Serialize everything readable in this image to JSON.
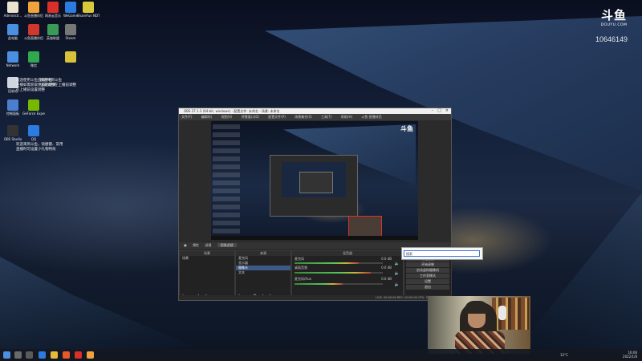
{
  "desktop": {
    "icons": [
      {
        "label": "Administr...",
        "color": "#e9e3d0"
      },
      {
        "label": "斗鱼直播伴侣",
        "color": "#f2a23a"
      },
      {
        "label": "网易云音乐",
        "color": "#d9302a"
      },
      {
        "label": "WeGame",
        "color": "#2b7be0"
      },
      {
        "label": "ShareFun NDTV",
        "color": "#d9c93a"
      },
      {
        "label": "此电脑",
        "color": "#4a8fe0"
      },
      {
        "label": "斗鱼直播伴侣",
        "color": "#d0382e"
      },
      {
        "label": "英雄联盟",
        "color": "#3a9a56"
      },
      {
        "label": "Steam",
        "color": "#777777"
      },
      {
        "label": "Network",
        "color": "#4a8fe0"
      },
      {
        "label": "微信",
        "color": "#2fa84e"
      },
      {
        "label": "",
        "color": "#d8c23a"
      },
      {
        "label": "回收站",
        "color": "#cfd6df"
      },
      {
        "label": "控制面板",
        "color": "#4a7fd0"
      },
      {
        "label": "GeForce Experience",
        "color": "#76b900"
      },
      {
        "label": "OBS Studio",
        "color": "#333333"
      },
      {
        "label": "QQ",
        "color": "#2b7be0"
      }
    ],
    "notes": [
      "欢迎使用斗鱼直播伴侣",
      "主播如需获取更多功能请",
      "在上播前设置调整",
      "欢迎来到斗鱼，快捷键、常用",
      "直播时可设置小礼物特效",
      "欢迎来到斗鱼",
      "设置调整在上播前调整"
    ]
  },
  "brand": {
    "logo": "斗鱼",
    "domain": "DOUYU.COM",
    "room_number": "10646149"
  },
  "obs": {
    "title": "OBS 27.1.3 (64-bit, windows) - 配置文件: 未命名 - 场景: 未命名",
    "menu": [
      "文件(F)",
      "编辑(E)",
      "视图(V)",
      "停靠窗口(D)",
      "配置文件(P)",
      "场景集合(S)",
      "工具(T)",
      "帮助(H)",
      "斗鱼·直播伴侣"
    ],
    "dock_tabs": [
      "属性",
      "滤镜",
      "图像滤镜"
    ],
    "panels": {
      "scenes": {
        "title": "场景",
        "items": [
          "场景"
        ]
      },
      "sources": {
        "title": "来源",
        "items": [
          "麦克风",
          "显示器",
          "摄像头",
          "文本"
        ]
      },
      "mixer": {
        "title": "混音器",
        "channels": [
          {
            "name": "麦克风",
            "level": "0.0 dB"
          },
          {
            "name": "桌面音频",
            "level": "0.0 dB"
          },
          {
            "name": "麦克风/Aux",
            "level": "0.0 dB"
          }
        ]
      },
      "controls": {
        "title": "控件",
        "buttons": [
          "停止推流",
          "开始录制",
          "启动虚拟摄像机",
          "工作室模式",
          "设置",
          "退出"
        ]
      }
    },
    "status": "LIVE: 00:00:00   REC: 00:00:00   CPU: 3.2%, 30.00 fps"
  },
  "popup": {
    "placeholder": "搜索"
  },
  "taskbar": {
    "temp": "12°C",
    "time": "16:06",
    "date": "2022/1/6"
  }
}
